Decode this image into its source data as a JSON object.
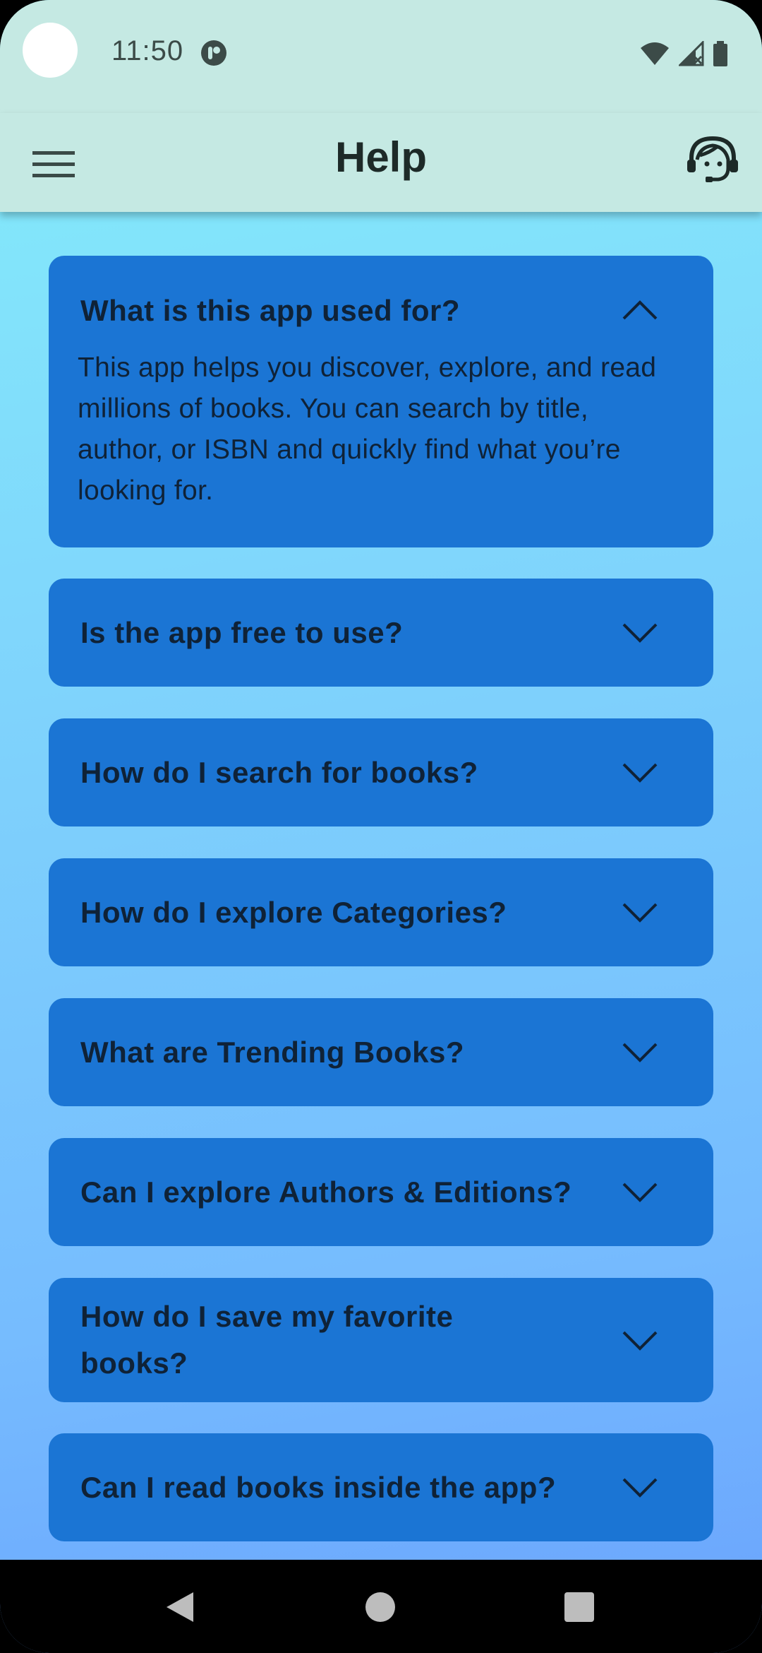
{
  "status_bar": {
    "time": "11:50",
    "icons": [
      "app-notification-icon",
      "wifi-icon",
      "cellular-signal-icon",
      "battery-icon"
    ]
  },
  "app_bar": {
    "title": "Help",
    "left_icon": "menu-icon",
    "right_icon": "support-agent-icon"
  },
  "faqs": [
    {
      "question": "What is this app used for?",
      "expanded": true,
      "answer": "This app helps you discover, explore, and read millions of books. You can search by title, author, or ISBN and quickly find what you’re looking for."
    },
    {
      "question": "Is the app free to use?",
      "expanded": false
    },
    {
      "question": "How do I search for books?",
      "expanded": false
    },
    {
      "question": "How do I explore Categories?",
      "expanded": false
    },
    {
      "question": "What are Trending Books?",
      "expanded": false
    },
    {
      "question": "Can I explore Authors & Editions?",
      "expanded": false
    },
    {
      "question": "How do I save my favorite books?",
      "expanded": false
    },
    {
      "question": "Can I read books inside the app?",
      "expanded": false
    }
  ],
  "colors": {
    "app_bar": "#c5e9e3",
    "card": "#1b75d4",
    "text": "#0f2237",
    "background_top": "#84eefa",
    "background_bottom": "#6aa3fd"
  },
  "nav_bar": {
    "icons": [
      "back-icon",
      "home-icon",
      "recents-icon"
    ]
  }
}
